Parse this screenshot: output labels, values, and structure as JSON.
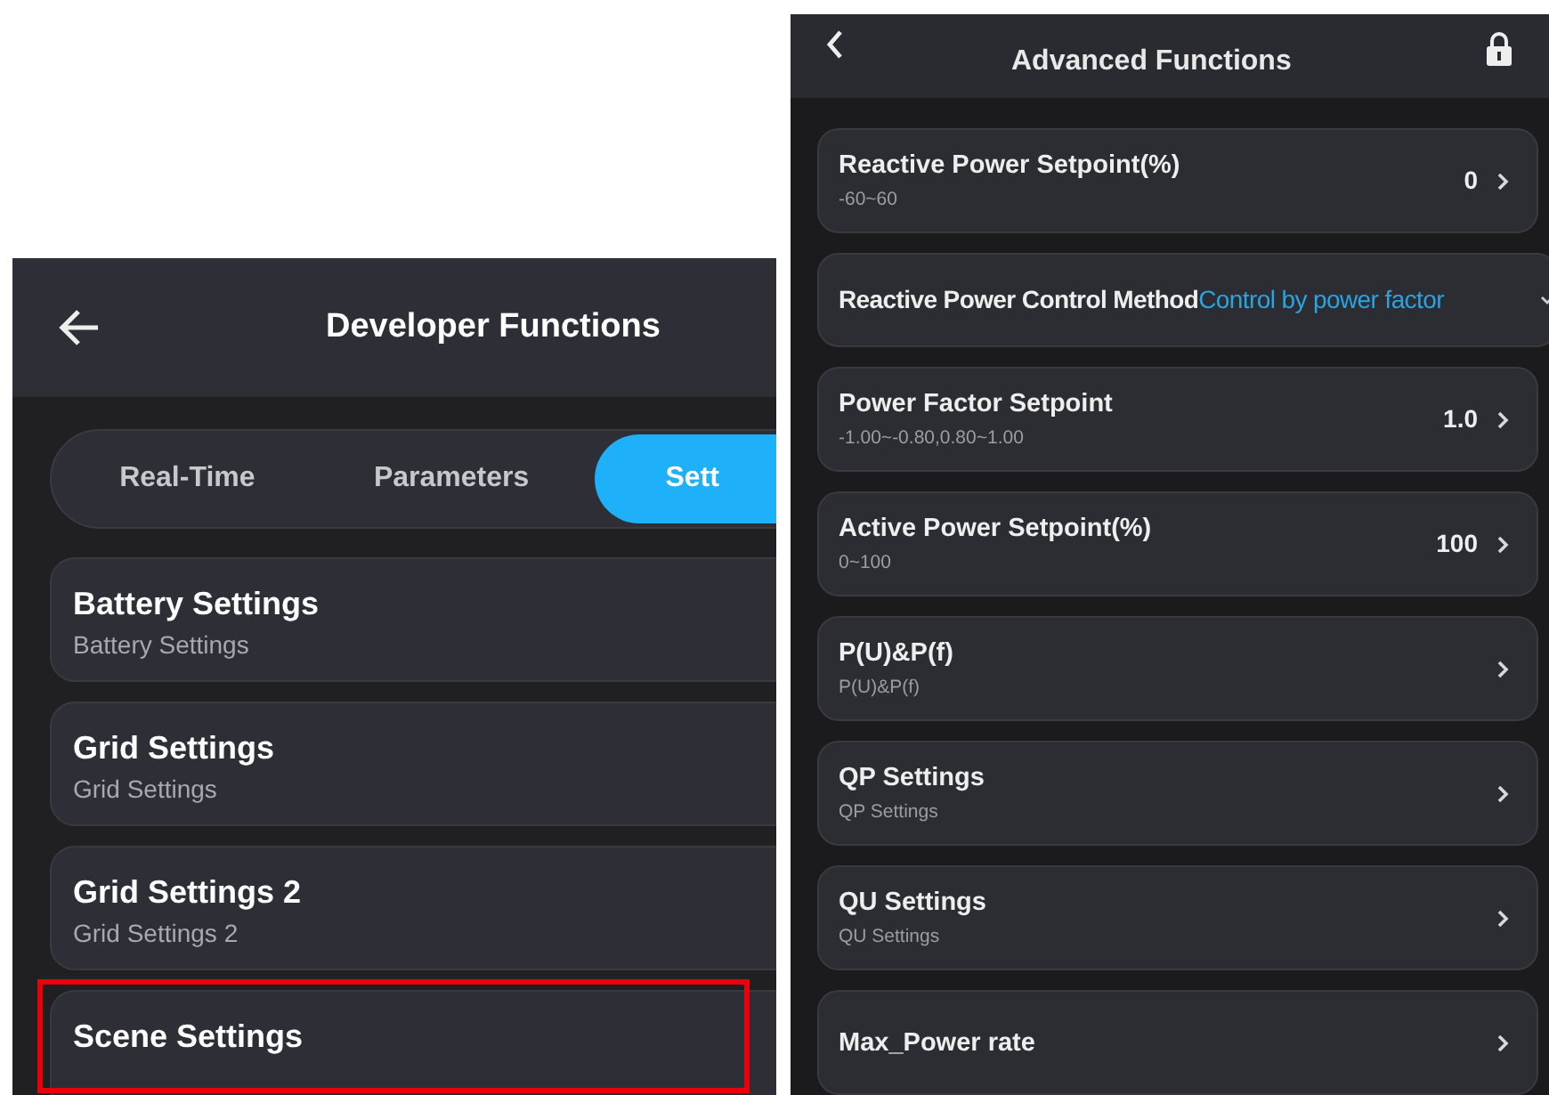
{
  "developer_screen": {
    "title": "Developer Functions",
    "tabs": [
      {
        "label": "Real-Time",
        "selected": false
      },
      {
        "label": "Parameters",
        "selected": false
      },
      {
        "label": "Sett",
        "selected": true
      }
    ],
    "items": [
      {
        "title": "Battery Settings",
        "subtitle": "Battery Settings"
      },
      {
        "title": "Grid Settings",
        "subtitle": "Grid Settings"
      },
      {
        "title": "Grid Settings 2",
        "subtitle": "Grid Settings 2"
      },
      {
        "title": "Scene Settings"
      }
    ]
  },
  "advanced_screen": {
    "title": "Advanced Functions",
    "rows": [
      {
        "kind": "value",
        "title": "Reactive Power Setpoint(%)",
        "subtitle": "-60~60",
        "value": "0"
      },
      {
        "kind": "dropdown",
        "title": "Reactive Power Control Method",
        "value": "Control by power factor"
      },
      {
        "kind": "value",
        "title": "Power Factor Setpoint",
        "subtitle": "-1.00~-0.80,0.80~1.00",
        "value": "1.0"
      },
      {
        "kind": "value",
        "title": "Active Power Setpoint(%)",
        "subtitle": "0~100",
        "value": "100"
      },
      {
        "kind": "value",
        "title": "P(U)&P(f)",
        "subtitle": "P(U)&P(f)"
      },
      {
        "kind": "value",
        "title": "QP Settings",
        "subtitle": "QP Settings"
      },
      {
        "kind": "value",
        "title": "QU Settings",
        "subtitle": "QU Settings"
      },
      {
        "kind": "value",
        "title": "Max_Power rate"
      }
    ]
  }
}
